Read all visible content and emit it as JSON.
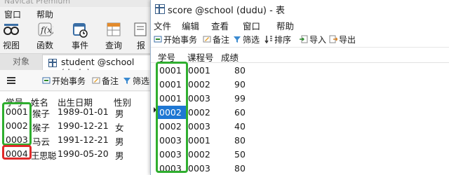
{
  "main_window": {
    "title": "Navicat Premium",
    "menu": [
      "窗口",
      "帮助"
    ],
    "toolbar": [
      {
        "label": "视图",
        "icon": "view-icon"
      },
      {
        "label": "函数",
        "icon": "function-icon"
      },
      {
        "label": "事件",
        "icon": "event-icon"
      },
      {
        "label": "查询",
        "icon": "query-icon"
      },
      {
        "label": "报",
        "icon": "report-icon"
      }
    ],
    "tabs": {
      "objects": "对象",
      "student": "student @school (dudu)"
    },
    "subtoolbar": {
      "begin_transaction": "开始事务",
      "note": "备注",
      "filter": "筛选"
    },
    "columns": [
      "学号",
      "姓名",
      "出生日期",
      "性别"
    ],
    "rows": [
      [
        "0001",
        "猴子",
        "1989-01-01",
        "男"
      ],
      [
        "0002",
        "猴子",
        "1990-12-21",
        "女"
      ],
      [
        "0003",
        "马云",
        "1991-12-21",
        "男"
      ],
      [
        "0004",
        "王思聪",
        "1990-05-20",
        "男"
      ]
    ]
  },
  "dialog": {
    "title": "score @school (dudu) - 表",
    "menu": [
      "文件",
      "编辑",
      "查看",
      "窗口",
      "帮助"
    ],
    "toolbar": {
      "begin_transaction": "开始事务",
      "note": "备注",
      "filter": "筛选",
      "sort": "排序",
      "import": "导入",
      "export": "导出"
    },
    "columns": [
      "学号",
      "课程号",
      "成绩"
    ],
    "rows": [
      [
        "0001",
        "0001",
        "80"
      ],
      [
        "0001",
        "0002",
        "90"
      ],
      [
        "0001",
        "0003",
        "99"
      ],
      [
        "0002",
        "0002",
        "60"
      ],
      [
        "0002",
        "0003",
        "40"
      ],
      [
        "0003",
        "0001",
        "80"
      ],
      [
        "0003",
        "0002",
        "50"
      ],
      [
        "0003",
        "0003",
        "80"
      ]
    ],
    "selected_row": 3
  },
  "annotation_colors": {
    "matched": "#2fae2f",
    "unmatched": "#e02a2a",
    "selection": "#1e77d3"
  }
}
